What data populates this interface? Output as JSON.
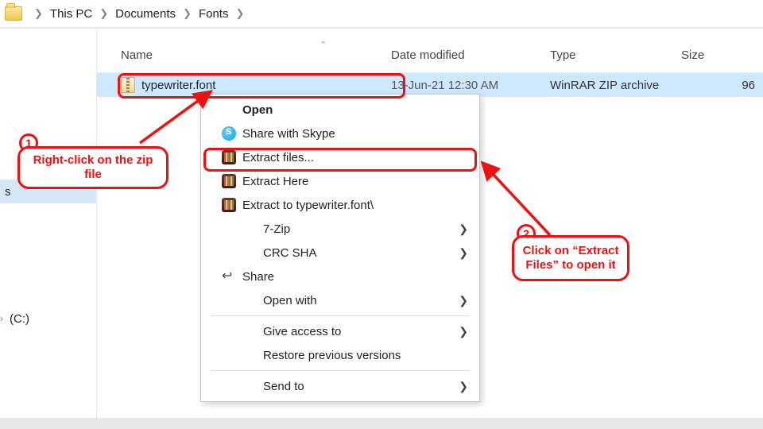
{
  "breadcrumb": {
    "parts": [
      "This PC",
      "Documents",
      "Fonts"
    ]
  },
  "sidebar": {
    "items": [
      {
        "label": "s",
        "selected": true
      },
      {
        "label": ""
      },
      {
        "label": ""
      },
      {
        "label": ""
      }
    ],
    "drive_label": "(C:)"
  },
  "columns": {
    "name": "Name",
    "date": "Date modified",
    "type": "Type",
    "size": "Size"
  },
  "file": {
    "name": "typewriter.font",
    "date": "13-Jun-21 12:30 AM",
    "type": "WinRAR ZIP archive",
    "size": "96"
  },
  "menu": {
    "open": "Open",
    "skype": "Share with Skype",
    "extract_files": "Extract files...",
    "extract_here": "Extract Here",
    "extract_to": "Extract to typewriter.font\\",
    "seven_zip": "7-Zip",
    "crc": "CRC SHA",
    "share": "Share",
    "open_with": "Open with",
    "give_access": "Give access to",
    "restore": "Restore previous versions",
    "send_to": "Send to"
  },
  "annotations": {
    "step1_num": "1",
    "step1_text": "Right-click on the zip file",
    "step2_num": "2",
    "step2_text": "Click on “Extract Files” to open it"
  }
}
